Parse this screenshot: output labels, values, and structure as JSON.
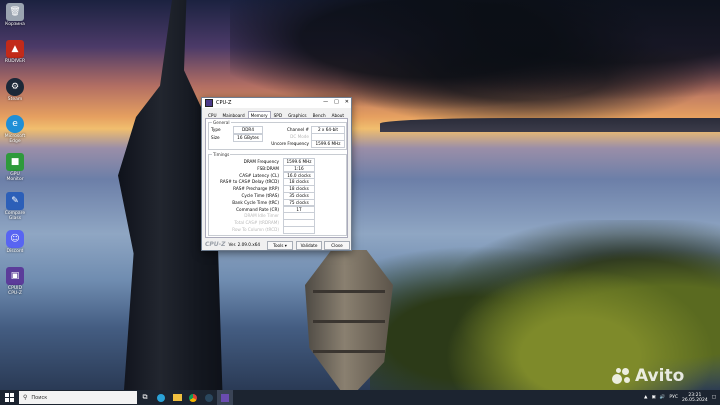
{
  "desktop": {
    "icons": [
      {
        "label": "Корзина",
        "icon": "recycle-bin-icon",
        "color": "#9aa4b0"
      },
      {
        "label": "RUDIVER",
        "icon": "app-red-icon",
        "color": "#c22a1a"
      },
      {
        "label": "Steam",
        "icon": "steam-icon",
        "color": "#1b2838"
      },
      {
        "label": "Microsoft Edge",
        "icon": "edge-icon",
        "color": "#1f8fd6"
      },
      {
        "label": "GPU Monitor",
        "icon": "gpu-monitor-icon",
        "color": "#2e9a3c"
      },
      {
        "label": "Compare Glass",
        "icon": "tool-icon",
        "color": "#2c5fb8"
      },
      {
        "label": "Discord",
        "icon": "discord-icon",
        "color": "#5865f2"
      },
      {
        "label": "CPUID CPU-Z",
        "icon": "cpuz-icon",
        "color": "#5b3c9a"
      }
    ]
  },
  "cpuz": {
    "title": "CPU-Z",
    "controls": {
      "minimize": "—",
      "maximize": "□",
      "close": "✕"
    },
    "tabs": [
      "CPU",
      "Mainboard",
      "Memory",
      "SPD",
      "Graphics",
      "Bench",
      "About"
    ],
    "active_tab": "Memory",
    "general": {
      "legend": "General",
      "type_label": "Type",
      "type_value": "DDR4",
      "size_label": "Size",
      "size_value": "16 GBytes",
      "channel_label": "Channel #",
      "channel_value": "2 x 64-bit",
      "dc_mode_label": "DC Mode",
      "uncore_label": "Uncore Frequency",
      "uncore_value": "1599.6 MHz"
    },
    "timings": {
      "legend": "Timings",
      "rows": [
        {
          "label": "DRAM Frequency",
          "value": "1599.6 MHz",
          "dim": false
        },
        {
          "label": "FSB:DRAM",
          "value": "1:16",
          "dim": false
        },
        {
          "label": "CAS# Latency (CL)",
          "value": "16.0 clocks",
          "dim": false
        },
        {
          "label": "RAS# to CAS# Delay (tRCD)",
          "value": "18 clocks",
          "dim": false
        },
        {
          "label": "RAS# Precharge (tRP)",
          "value": "18 clocks",
          "dim": false
        },
        {
          "label": "Cycle Time (tRAS)",
          "value": "35 clocks",
          "dim": false
        },
        {
          "label": "Bank Cycle Time (tRC)",
          "value": "75 clocks",
          "dim": false
        },
        {
          "label": "Command Rate (CR)",
          "value": "1T",
          "dim": false
        },
        {
          "label": "DRAM Idle Timer",
          "value": "",
          "dim": true
        },
        {
          "label": "Total CAS# (tRDRAM)",
          "value": "",
          "dim": true
        },
        {
          "label": "Row To Column (tRCD)",
          "value": "",
          "dim": true
        }
      ]
    },
    "footer": {
      "logo": "CPU-Z",
      "version": "Ver. 2.09.0.x64",
      "tools": "Tools",
      "validate": "Validate",
      "close": "Close"
    }
  },
  "taskbar": {
    "search_placeholder": "Поиск",
    "apps": [
      "task-view-icon",
      "edge-icon",
      "file-explorer-icon",
      "chrome-icon",
      "steam-icon",
      "cpuz-icon"
    ],
    "lang": "РУС",
    "time": "23:21",
    "date": "26.05.2024"
  },
  "watermark": {
    "text": "Avito"
  }
}
